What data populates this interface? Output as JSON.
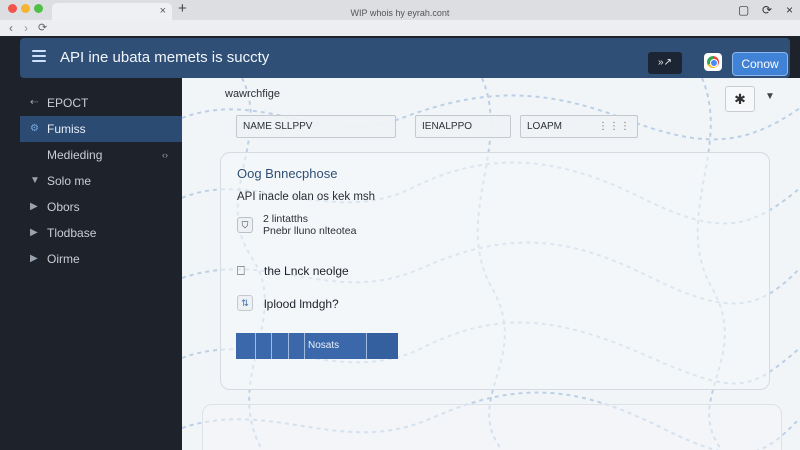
{
  "browser": {
    "url": "WIP whois hy eyrah.cont",
    "tab_close": "×",
    "new_tab": "+",
    "nav_back": "‹",
    "nav_forward": "›",
    "reload": "⟳",
    "win_min": "▢",
    "win_max": "⟳",
    "win_close": "×"
  },
  "header": {
    "title": "API ine ubata memets is succty",
    "ext_button": "»↗",
    "primary_button": "Conow",
    "accent": "#2f4f76"
  },
  "sidebar": {
    "items": [
      {
        "icon": "arrow-left-icon",
        "glyph": "⇠",
        "label": "EPOCT"
      },
      {
        "icon": "gear-icon",
        "glyph": "⚙",
        "label": "Fumiss"
      },
      {
        "icon": "",
        "glyph": "",
        "label": "Medieding",
        "chevron": "‹›"
      },
      {
        "icon": "filter-icon",
        "glyph": "▼",
        "label": "Solo me"
      },
      {
        "icon": "play-icon",
        "glyph": "▶",
        "label": "Obors"
      },
      {
        "icon": "play-icon",
        "glyph": "▶",
        "label": "Tlodbase"
      },
      {
        "icon": "play-icon",
        "glyph": "▶",
        "label": "Oirme"
      }
    ]
  },
  "main": {
    "title": "wawrchfige",
    "tool_button": "✱",
    "chevron": "▼",
    "fields": [
      {
        "value": "NAME SLLPPV",
        "dots": ""
      },
      {
        "value": "IENALPPO",
        "dots": ""
      },
      {
        "value": "LOAPM",
        "dots": "⋮⋮⋮"
      }
    ],
    "card": {
      "title": "Oog Bnnecphose",
      "subtitle": "API inacle olan os kek msh",
      "shield_glyph": "⛉",
      "line1": "2 lintatths",
      "line2": "Pnebr lluno nlteotea",
      "item1_glyph": "⎕",
      "item1_label": "the Lnck neolge",
      "item2_glyph": "⇅",
      "item2_label": "lplood lmdgh?",
      "bar_label": "Nosats"
    }
  }
}
